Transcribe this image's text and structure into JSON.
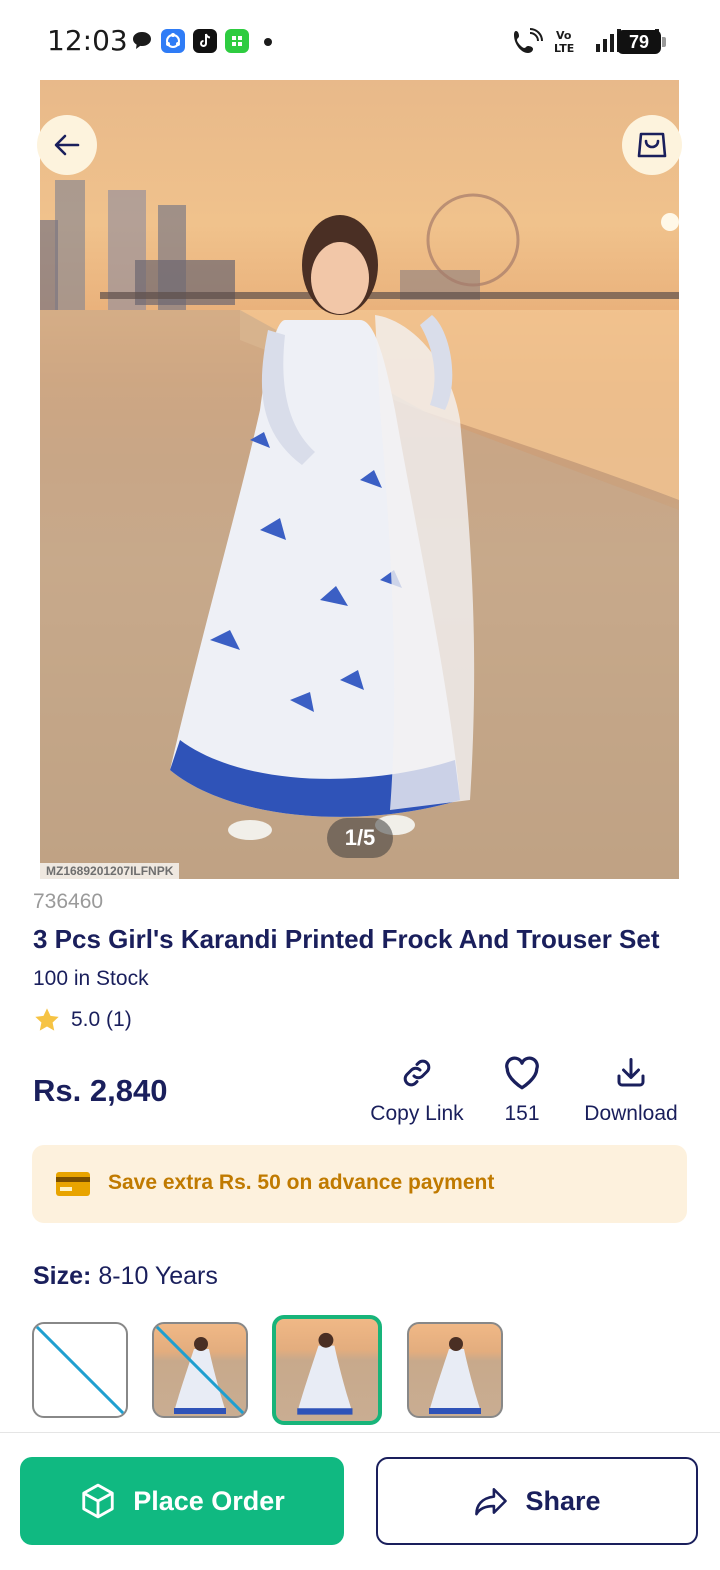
{
  "status_bar": {
    "time": "12:03",
    "battery": "79",
    "app_icons": [
      "chat-bubble-icon",
      "blue-app-icon",
      "tiktok-icon",
      "green-app-icon"
    ],
    "right_icons": [
      "wifi-call-icon",
      "volte-icon",
      "signal-1-icon",
      "signal-2-icon"
    ]
  },
  "hero": {
    "image_counter": "1/5",
    "sku": "MZ1689201207ILFNPK"
  },
  "product": {
    "id": "736460",
    "title": "3 Pcs Girl's Karandi Printed Frock And Trouser Set",
    "stock": "100 in Stock",
    "rating": "5.0 (1)",
    "price": "Rs. 2,840"
  },
  "actions": {
    "copy_link": "Copy Link",
    "likes": "151",
    "download": "Download"
  },
  "promo": {
    "text": "Save extra Rs. 50 on advance payment"
  },
  "size": {
    "label": "Size:",
    "value": "8-10 Years"
  },
  "swatches": [
    {
      "state": "unavailable",
      "image": false
    },
    {
      "state": "unavailable",
      "image": true
    },
    {
      "state": "selected",
      "image": true
    },
    {
      "state": "available",
      "image": true
    }
  ],
  "bottom": {
    "place_order": "Place Order",
    "share": "Share"
  },
  "colors": {
    "primary_green": "#10b981",
    "navy": "#1a1f5c",
    "promo_bg": "#fdf1dd",
    "promo_text": "#c07a00",
    "star": "#f6c343"
  }
}
